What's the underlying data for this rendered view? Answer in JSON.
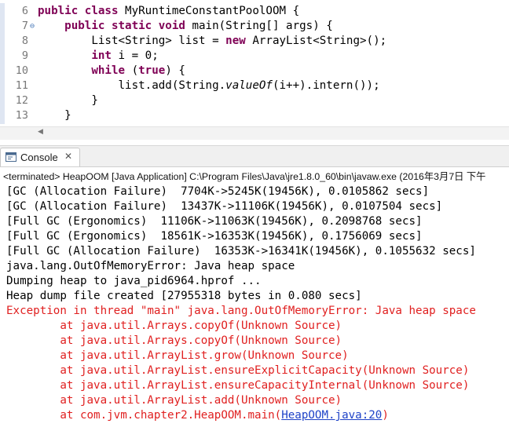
{
  "editor": {
    "lines": [
      {
        "num": "6",
        "marker": "",
        "segs": [
          [
            "kw",
            "public class "
          ],
          [
            "n",
            "MyRuntimeConstantPoolOOM {"
          ]
        ]
      },
      {
        "num": "7",
        "marker": "⊖",
        "segs": [
          [
            "n",
            "    "
          ],
          [
            "kw",
            "public static void "
          ],
          [
            "n",
            "main(String[] args) {"
          ]
        ]
      },
      {
        "num": "8",
        "marker": "",
        "segs": [
          [
            "n",
            "        List<String> list = "
          ],
          [
            "kw",
            "new "
          ],
          [
            "n",
            "ArrayList<String>();"
          ]
        ]
      },
      {
        "num": "9",
        "marker": "",
        "segs": [
          [
            "n",
            "        "
          ],
          [
            "kw",
            "int "
          ],
          [
            "n",
            "i = 0;"
          ]
        ]
      },
      {
        "num": "10",
        "marker": "",
        "segs": [
          [
            "n",
            "        "
          ],
          [
            "kw",
            "while "
          ],
          [
            "n",
            "("
          ],
          [
            "kw",
            "true"
          ],
          [
            "n",
            ") {"
          ]
        ]
      },
      {
        "num": "11",
        "marker": "",
        "segs": [
          [
            "n",
            "            list.add(String."
          ],
          [
            "it",
            "valueOf"
          ],
          [
            "n",
            "(i++).intern());"
          ]
        ]
      },
      {
        "num": "12",
        "marker": "",
        "segs": [
          [
            "n",
            "        }"
          ]
        ]
      },
      {
        "num": "13",
        "marker": "",
        "segs": [
          [
            "n",
            "    }"
          ]
        ]
      }
    ]
  },
  "scrollbar": {
    "arrow": "◀"
  },
  "console": {
    "tab_label": "Console",
    "close_glyph": "✕",
    "terminated": "<terminated> HeapOOM [Java Application] C:\\Program Files\\Java\\jre1.8.0_60\\bin\\javaw.exe (2016年3月7日 下午",
    "output": [
      {
        "text": "[GC (Allocation Failure)  7704K->5245K(19456K), 0.0105862 secs]",
        "err": false
      },
      {
        "text": "[GC (Allocation Failure)  13437K->11106K(19456K), 0.0107504 secs]",
        "err": false
      },
      {
        "text": "[Full GC (Ergonomics)  11106K->11063K(19456K), 0.2098768 secs]",
        "err": false
      },
      {
        "text": "[Full GC (Ergonomics)  18561K->16353K(19456K), 0.1756069 secs]",
        "err": false
      },
      {
        "text": "[Full GC (Allocation Failure)  16353K->16341K(19456K), 0.1055632 secs]",
        "err": false
      },
      {
        "text": "java.lang.OutOfMemoryError: Java heap space",
        "err": false
      },
      {
        "text": "Dumping heap to java_pid6964.hprof ...",
        "err": false
      },
      {
        "text": "Heap dump file created [27955318 bytes in 0.080 secs]",
        "err": false
      },
      {
        "text": "Exception in thread \"main\" java.lang.OutOfMemoryError: Java heap space",
        "err": true
      },
      {
        "text": "\tat java.util.Arrays.copyOf(Unknown Source)",
        "err": true
      },
      {
        "text": "\tat java.util.Arrays.copyOf(Unknown Source)",
        "err": true
      },
      {
        "text": "\tat java.util.ArrayList.grow(Unknown Source)",
        "err": true
      },
      {
        "text": "\tat java.util.ArrayList.ensureExplicitCapacity(Unknown Source)",
        "err": true
      },
      {
        "text": "\tat java.util.ArrayList.ensureCapacityInternal(Unknown Source)",
        "err": true
      },
      {
        "text": "\tat java.util.ArrayList.add(Unknown Source)",
        "err": true
      },
      {
        "text": "\tat com.jvm.chapter2.HeapOOM.main(",
        "err": true,
        "link": "HeapOOM.java:20",
        "tail": ")"
      }
    ]
  },
  "colors": {
    "keyword": "#7f0055",
    "error": "#e02020",
    "link": "#1f43c8"
  }
}
